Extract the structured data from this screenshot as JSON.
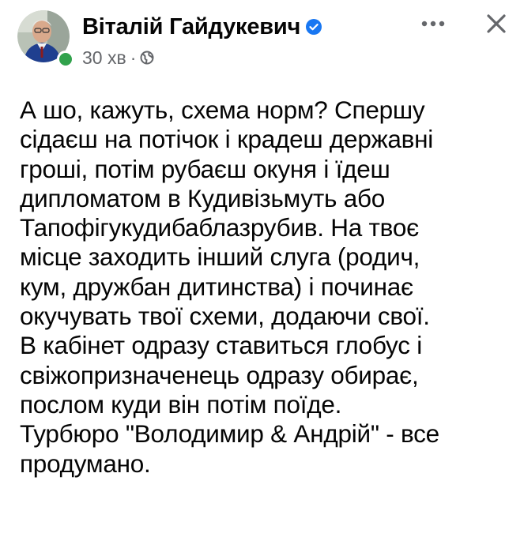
{
  "post": {
    "author": {
      "name": "Віталій Гайдукевич",
      "verified_icon": "verified-badge-icon",
      "avatar_icon": "profile-photo",
      "online_status_color": "#31a24c"
    },
    "timestamp": "30 хв",
    "separator": "·",
    "audience_icon": "globe-icon",
    "actions": {
      "more_icon": "more-options-icon",
      "close_icon": "close-icon"
    },
    "text_lines": [
      "А шо, кажуть, схема норм? Спершу",
      "сідаєш на потічок і крадеш державні",
      "гроші, потім рубаєш окуня і їдеш",
      "дипломатом в Кудивізьмуть або",
      "Тапофігукудибаблазрубив. На твоє",
      "місце заходить інший слуга (родич,",
      "кум, дружбан дитинства) і починає",
      "окучувать твої схеми, додаючи свої.",
      "В кабінет одразу ставиться глобус і",
      "свіжопризначенець одразу обирає,",
      "послом куди він потім поїде.",
      "Турбюро \"Володимир & Андрій\" - все",
      "продумано."
    ]
  },
  "colors": {
    "text_primary": "#050505",
    "text_secondary": "#65676b",
    "verified_blue": "#1877f2",
    "background": "#ffffff"
  }
}
